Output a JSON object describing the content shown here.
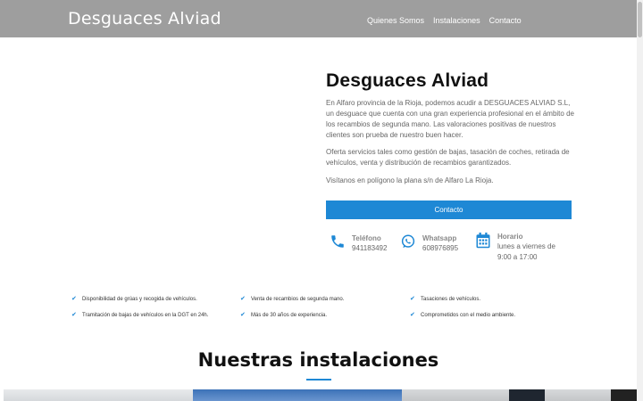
{
  "header": {
    "brand": "Desguaces Alviad",
    "nav": [
      "Quienes Somos",
      "Instalaciones",
      "Contacto"
    ]
  },
  "intro": {
    "title": "Desguaces Alviad",
    "paragraphs": [
      "En Alfaro provincia de la Rioja, podemos acudir a DESGUACES ALVIAD S.L, un desguace que cuenta con una gran experiencia profesional en el ámbito de los recambios de segunda mano. Las valoraciones positivas de nuestros clientes son prueba de nuestro buen hacer.",
      "Oferta servicios tales como gestión de bajas, tasación de coches, retirada de vehículos, venta y distribución de recambios garantizados.",
      "Visítanos en polígono la plana s/n de Alfaro La Rioja."
    ],
    "button": "Contacto"
  },
  "contact": {
    "phone": {
      "title": "Teléfono",
      "value": "941183492",
      "icon": "phone-icon"
    },
    "whatsapp": {
      "title": "Whatsapp",
      "value": "608976895",
      "icon": "whatsapp-icon"
    },
    "hours": {
      "title": "Horario",
      "line1": "lunes a viernes de",
      "line2": "9:00 a 17:00",
      "icon": "calendar-icon"
    }
  },
  "features": [
    "Disponibilidad de grúas y recogida de vehículos.",
    "Venta de recambios de segunda mano.",
    "Tasaciones de vehículos.",
    "Tramitación de bajas de vehículos en la DGT en 24h.",
    "Más de 30 años de experiencia.",
    "Comprometidos con el medio ambiente."
  ],
  "gallery": {
    "title": "Nuestras instalaciones"
  },
  "colors": {
    "header": "#9e9e9e",
    "accent": "#1e88d5"
  }
}
